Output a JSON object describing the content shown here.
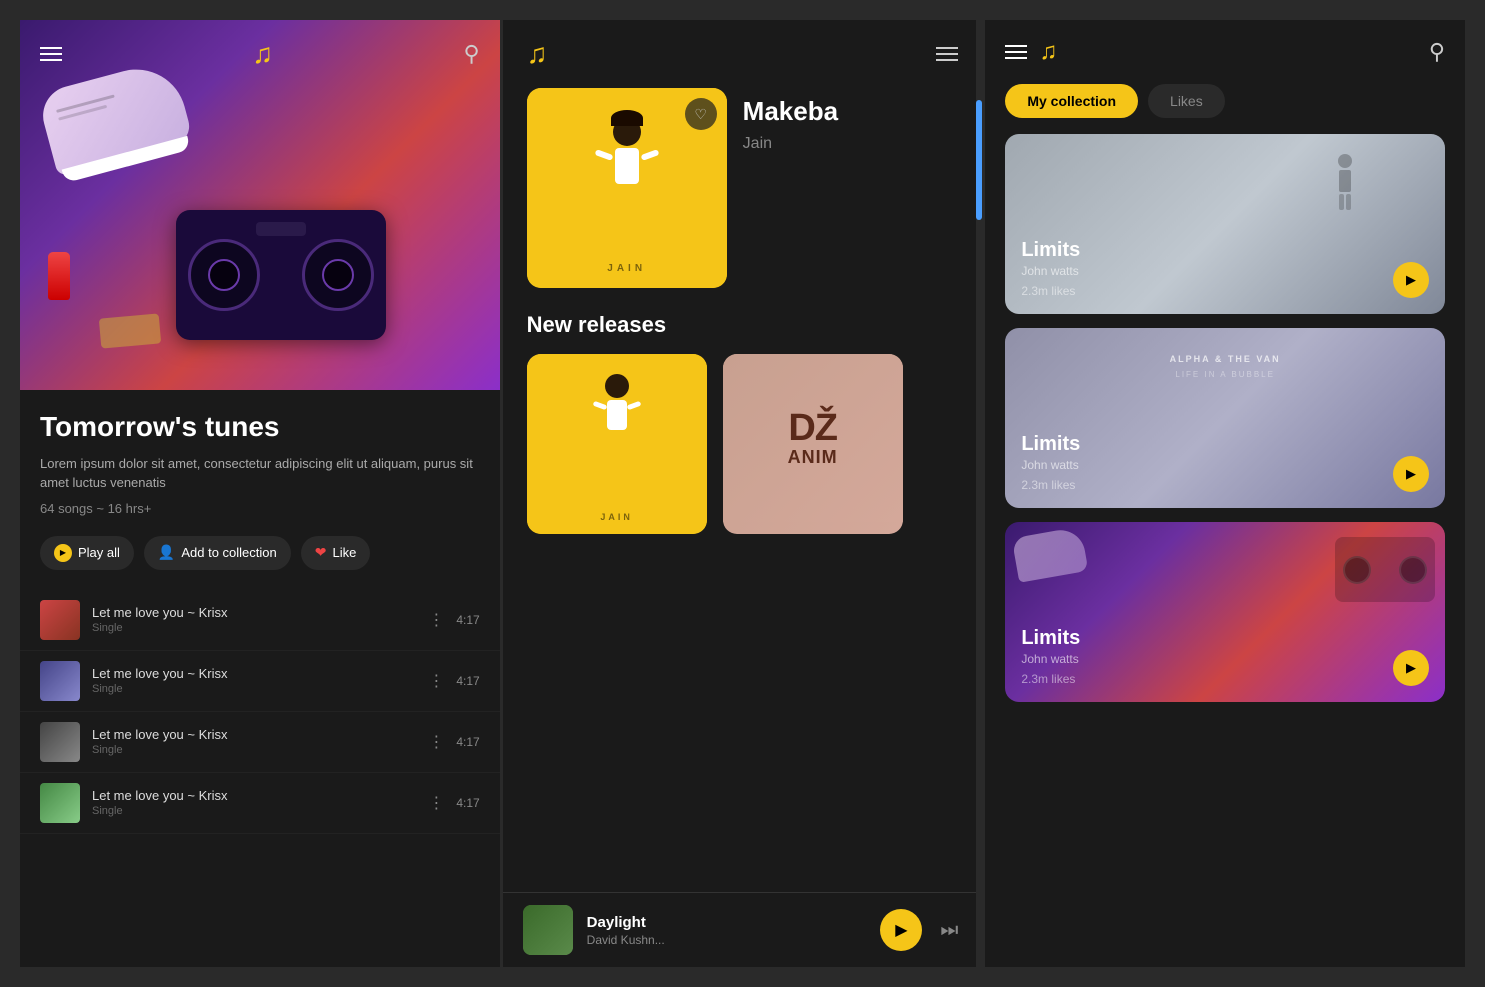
{
  "app": {
    "logo_symbol": "♫",
    "search_symbol": "🔍",
    "hamburger_lines": 3
  },
  "panel1": {
    "header": {
      "logo": "♫",
      "search_icon": "⌕"
    },
    "hero": {
      "title": "Tomorrow's tunes",
      "description": "Lorem ipsum dolor sit amet, consectetur adipiscing elit ut aliquam, purus sit amet luctus venenatis",
      "meta": "64 songs ~ 16 hrs+"
    },
    "actions": {
      "play_all": "Play all",
      "add_collection": "Add to collection",
      "like": "Like"
    },
    "tracks": [
      {
        "id": 1,
        "name": "Let me love you ~ Krisx",
        "type": "Single",
        "duration": "4:17",
        "thumb_class": "track-thumb-1"
      },
      {
        "id": 2,
        "name": "Let me love you ~ Krisx",
        "type": "Single",
        "duration": "4:17",
        "thumb_class": "track-thumb-2"
      },
      {
        "id": 3,
        "name": "Let me love you ~ Krisx",
        "type": "Single",
        "duration": "4:17",
        "thumb_class": "track-thumb-3"
      },
      {
        "id": 4,
        "name": "Let me love you ~ Krisx",
        "type": "Single",
        "duration": "4:17",
        "thumb_class": "track-thumb-4"
      }
    ]
  },
  "panel2": {
    "header": {
      "logo": "♫"
    },
    "album": {
      "art_label": "JAIN",
      "title": "Makeba",
      "artist": "Jain",
      "heart_icon": "♡"
    },
    "new_releases": {
      "section_title": "New releases",
      "releases": [
        {
          "id": 1,
          "type": "yellow"
        },
        {
          "id": 2,
          "label": "DŽ\nANIM",
          "type": "brown"
        }
      ]
    },
    "now_playing": {
      "title": "Daylight",
      "artist": "David Kushn...",
      "play_icon": "▶",
      "next_icon": "⏭"
    }
  },
  "panel3": {
    "header": {
      "logo": "♫",
      "search_icon": "⌕"
    },
    "tabs": {
      "active": "My collection",
      "inactive": "Likes"
    },
    "collection_cards": [
      {
        "id": 1,
        "type": "gray_figure",
        "title": "Limits",
        "artist": "John watts",
        "likes": "2.3m likes",
        "play_icon": "▶"
      },
      {
        "id": 2,
        "type": "alpha_bubble",
        "header_text": "ALPHA & THE VAN",
        "sub_text": "LIFE IN A BUBBLE",
        "title": "Limits",
        "artist": "John watts",
        "likes": "2.3m likes",
        "play_icon": "▶"
      },
      {
        "id": 3,
        "type": "boombox",
        "title": "Limits",
        "artist": "John watts",
        "likes": "2.3m likes",
        "play_icon": "▶"
      }
    ]
  }
}
